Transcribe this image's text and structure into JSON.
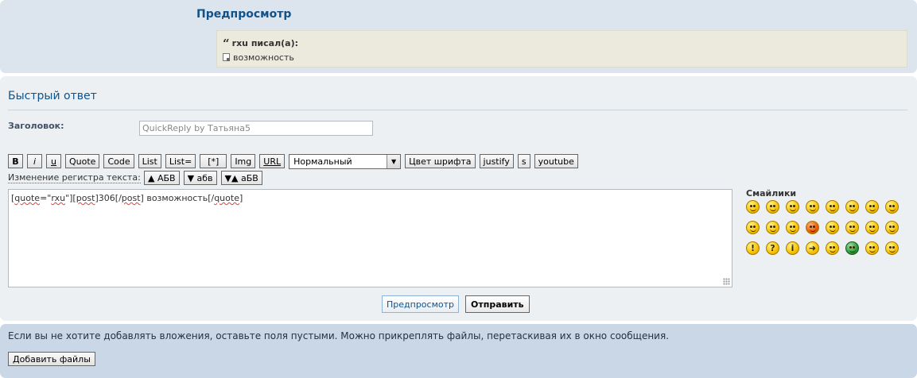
{
  "preview": {
    "heading": "Предпросмотр",
    "quote_author": "rxu писал(а):",
    "quote_text": "возможность"
  },
  "reply": {
    "heading": "Быстрый ответ",
    "subject_label": "Заголовок:",
    "subject_value": "QuickReply by Татьяна5",
    "toolbar": {
      "bold": "B",
      "italic": "i",
      "underline": "u",
      "quote": "Quote",
      "code": "Code",
      "list": "List",
      "list_eq": "List=",
      "list_item": "[*]",
      "img": "Img",
      "url": "URL",
      "font_size": "Нормальный",
      "font_color": "Цвет шрифта",
      "justify": "justify",
      "strike": "s",
      "youtube": "youtube"
    },
    "case": {
      "label": "Изменение регистра текста:",
      "upper": "▲ АБВ",
      "lower": "▼ абв",
      "invert": "▼▲ аБВ"
    },
    "message_parts": [
      "[",
      "quote",
      "=\"",
      "rxu",
      "\"][",
      "post",
      "]306[/",
      "post",
      "] возможность[/",
      "quote",
      "]"
    ],
    "smilies_title": "Смайлики",
    "smilies": [
      "smile-icon",
      "biggrin-icon",
      "wink-icon",
      "neutral-icon",
      "surprised-icon",
      "eek-icon",
      "confused-icon",
      "cool-icon",
      "lol-icon",
      "mad-icon",
      "razz-icon",
      "redface-icon",
      "cry-icon",
      "evil-icon",
      "twisted-icon",
      "rolleyes-icon",
      "exclaim-icon",
      "question-icon",
      "idea-icon",
      "arrow-icon",
      "sad-icon",
      "mrgreen-icon",
      "geek-icon",
      "ugeek-icon"
    ],
    "preview_button": "Предпросмотр",
    "submit_button": "Отправить"
  },
  "attachments": {
    "notice": "Если вы не хотите добавлять вложения, оставьте поля пустыми. Можно прикреплять файлы, перетаскивая их в окно сообщения.",
    "add_files_button": "Добавить файлы"
  }
}
